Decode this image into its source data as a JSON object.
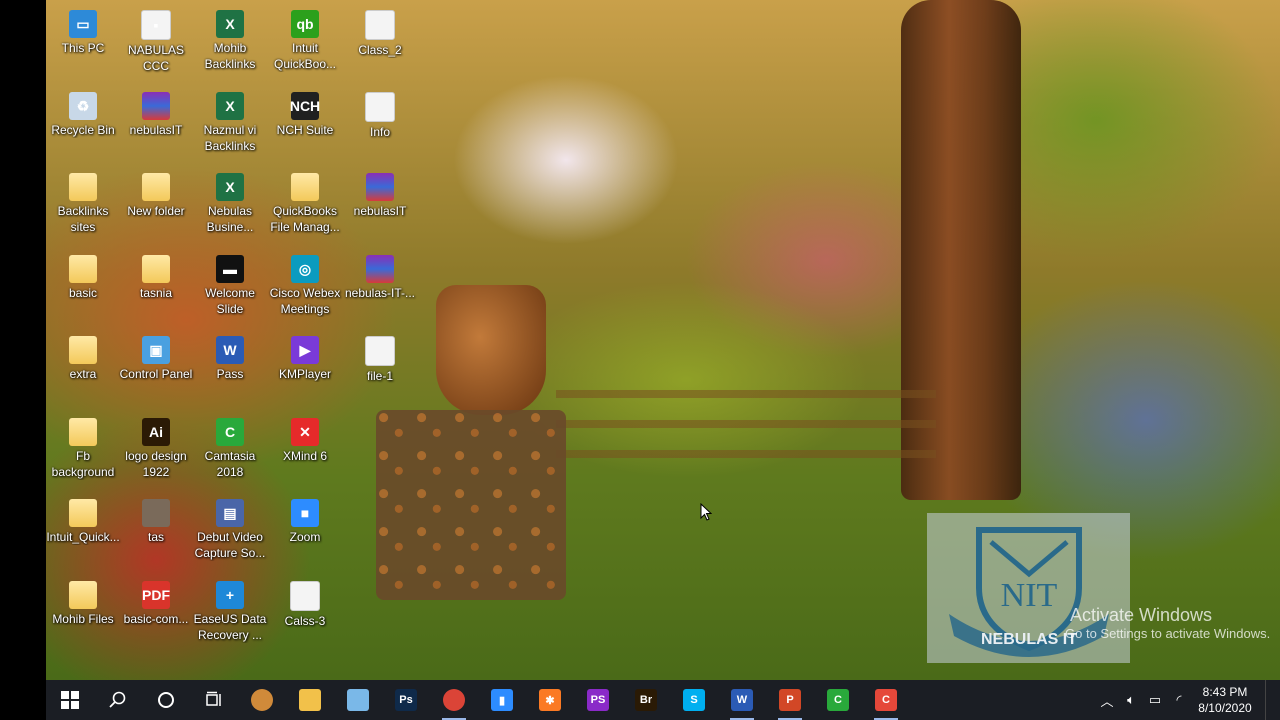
{
  "desktop": {
    "icons": [
      {
        "label": "This PC",
        "icon": "computer-icon",
        "glyph": "▭",
        "cls": "g-pc"
      },
      {
        "label": "Recycle Bin",
        "icon": "recycle-bin-icon",
        "glyph": "♻",
        "cls": "g-bin"
      },
      {
        "label": "Backlinks sites",
        "icon": "folder-icon",
        "glyph": "",
        "cls": "g-folder"
      },
      {
        "label": "basic",
        "icon": "folder-icon",
        "glyph": "",
        "cls": "g-folder"
      },
      {
        "label": "extra",
        "icon": "folder-icon",
        "glyph": "",
        "cls": "g-folder"
      },
      {
        "label": "Fb background",
        "icon": "folder-icon",
        "glyph": "",
        "cls": "g-folder"
      },
      {
        "label": "Intuit_Quick...",
        "icon": "folder-icon",
        "glyph": "",
        "cls": "g-folder"
      },
      {
        "label": "Mohib Files",
        "icon": "folder-icon",
        "glyph": "",
        "cls": "g-folder"
      },
      {
        "label": "NABULAS CCC",
        "icon": "app-icon",
        "glyph": "▪",
        "cls": "g-file"
      },
      {
        "label": "nebulasIT",
        "icon": "winrar-icon",
        "glyph": "",
        "cls": "g-rar"
      },
      {
        "label": "New folder",
        "icon": "folder-icon",
        "glyph": "",
        "cls": "g-folder"
      },
      {
        "label": "tasnia",
        "icon": "folder-icon",
        "glyph": "",
        "cls": "g-folder"
      },
      {
        "label": "Control Panel",
        "icon": "control-panel-icon",
        "glyph": "▣",
        "cls": "g-ctrl"
      },
      {
        "label": "logo design 1922",
        "icon": "illustrator-icon",
        "glyph": "Ai",
        "cls": "g-ai"
      },
      {
        "label": "tas",
        "icon": "image-file-icon",
        "glyph": "",
        "cls": "g-tas"
      },
      {
        "label": "basic-com...",
        "icon": "pdf-icon",
        "glyph": "PDF",
        "cls": "g-pdf"
      },
      {
        "label": "Mohib Backlinks",
        "icon": "excel-icon",
        "glyph": "X",
        "cls": "g-excel"
      },
      {
        "label": "Nazmul vi Backlinks",
        "icon": "excel-icon",
        "glyph": "X",
        "cls": "g-excel"
      },
      {
        "label": "Nebulas Busine...",
        "icon": "excel-icon",
        "glyph": "X",
        "cls": "g-excel"
      },
      {
        "label": "Welcome Slide",
        "icon": "slide-icon",
        "glyph": "▬",
        "cls": "g-slide"
      },
      {
        "label": "Pass",
        "icon": "word-icon",
        "glyph": "W",
        "cls": "g-word"
      },
      {
        "label": "Camtasia 2018",
        "icon": "camtasia-icon",
        "glyph": "C",
        "cls": "g-cam"
      },
      {
        "label": "Debut Video Capture So...",
        "icon": "debut-icon",
        "glyph": "▤",
        "cls": "g-debut"
      },
      {
        "label": "EaseUS Data Recovery ...",
        "icon": "easeus-icon",
        "glyph": "+",
        "cls": "g-ease"
      },
      {
        "label": "Intuit QuickBoo...",
        "icon": "quickbooks-icon",
        "glyph": "qb",
        "cls": "g-qb"
      },
      {
        "label": "NCH Suite",
        "icon": "nch-icon",
        "glyph": "NCH",
        "cls": "g-nch"
      },
      {
        "label": "QuickBooks File Manag...",
        "icon": "quickbooks-file-icon",
        "glyph": "",
        "cls": "g-folder"
      },
      {
        "label": "Cisco Webex Meetings",
        "icon": "webex-icon",
        "glyph": "◎",
        "cls": "g-webex"
      },
      {
        "label": "KMPlayer",
        "icon": "kmplayer-icon",
        "glyph": "▶",
        "cls": "g-km"
      },
      {
        "label": "XMind 6",
        "icon": "xmind-icon",
        "glyph": "✕",
        "cls": "g-xmind"
      },
      {
        "label": "Zoom",
        "icon": "zoom-icon",
        "glyph": "■",
        "cls": "g-zoom"
      },
      {
        "label": "Calss-3",
        "icon": "file-icon",
        "glyph": "",
        "cls": "g-file"
      },
      {
        "label": "Class_2",
        "icon": "file-icon",
        "glyph": "",
        "cls": "g-file"
      },
      {
        "label": "Info",
        "icon": "text-file-icon",
        "glyph": "",
        "cls": "g-file"
      },
      {
        "label": "nebulasIT",
        "icon": "winrar-icon",
        "glyph": "",
        "cls": "g-rar"
      },
      {
        "label": "nebulas-IT-...",
        "icon": "winrar-icon",
        "glyph": "",
        "cls": "g-rar"
      },
      {
        "label": "file-1",
        "icon": "text-file-icon",
        "glyph": "",
        "cls": "g-file"
      }
    ]
  },
  "watermark": {
    "logo_text": "NEBULAS IT",
    "logo_mark": "NIT",
    "activate_title": "Activate Windows",
    "activate_sub": "Go to Settings to activate Windows."
  },
  "taskbar": {
    "apps": [
      {
        "name": "start-button",
        "icon": "windows-logo-icon"
      },
      {
        "name": "search-button",
        "icon": "search-icon"
      },
      {
        "name": "cortana-button",
        "icon": "cortana-circle-icon"
      },
      {
        "name": "task-view-button",
        "icon": "task-view-icon"
      },
      {
        "name": "taskbar-app-firefox",
        "icon": "browser-globe-icon",
        "glyph": "",
        "color": "#d08a3a"
      },
      {
        "name": "taskbar-app-file-explorer",
        "icon": "folder-icon",
        "glyph": "",
        "color": "#f2c14a"
      },
      {
        "name": "taskbar-app-notes",
        "icon": "notes-icon",
        "glyph": "",
        "color": "#7ab8e8"
      },
      {
        "name": "taskbar-app-photoshop",
        "icon": "photoshop-icon",
        "glyph": "Ps",
        "color": "#0f2a4a"
      },
      {
        "name": "taskbar-app-chrome",
        "icon": "chrome-icon",
        "glyph": "",
        "color": "#db4437",
        "active": true
      },
      {
        "name": "taskbar-app-zoom",
        "icon": "zoom-icon",
        "glyph": "▮",
        "color": "#2d8cff"
      },
      {
        "name": "taskbar-app-xampp",
        "icon": "xampp-icon",
        "glyph": "✱",
        "color": "#fb7a24"
      },
      {
        "name": "taskbar-app-phpstorm",
        "icon": "phpstorm-icon",
        "glyph": "PS",
        "color": "#8a2ac8"
      },
      {
        "name": "taskbar-app-bridge",
        "icon": "bridge-icon",
        "glyph": "Br",
        "color": "#2a1a05"
      },
      {
        "name": "taskbar-app-skype",
        "icon": "skype-icon",
        "glyph": "S",
        "color": "#00aff0"
      },
      {
        "name": "taskbar-app-word",
        "icon": "word-icon",
        "glyph": "W",
        "color": "#2b5bb5",
        "active": true
      },
      {
        "name": "taskbar-app-powerpoint",
        "icon": "powerpoint-icon",
        "glyph": "P",
        "color": "#d24726",
        "active": true
      },
      {
        "name": "taskbar-app-camtasia-green",
        "icon": "camtasia-icon",
        "glyph": "C",
        "color": "#29a93b"
      },
      {
        "name": "taskbar-app-camtasia-red",
        "icon": "camtasia-recorder-icon",
        "glyph": "C",
        "color": "#e5483a",
        "active": true
      }
    ],
    "tray": {
      "icons": [
        "chevron-up-icon",
        "speaker-icon",
        "battery-icon",
        "wifi-icon"
      ],
      "time": "8:43 PM",
      "date": "8/10/2020"
    }
  }
}
